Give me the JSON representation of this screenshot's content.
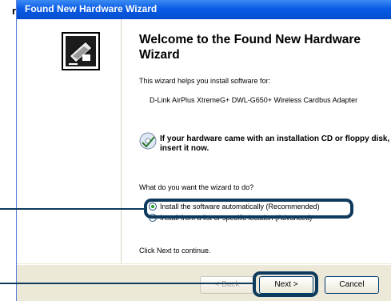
{
  "stray_char": "r",
  "window": {
    "title": "Found New Hardware Wizard"
  },
  "wizard": {
    "heading": "Welcome to the Found New Hardware Wizard",
    "intro": "This wizard helps you install software for:",
    "device": "D-Link AirPlus XtremeG+ DWL-G650+ Wireless Cardbus Adapter",
    "cd_prompt": "If your hardware came with an installation CD or floppy disk, insert it now.",
    "question": "What do you want the wizard to do?",
    "options": [
      {
        "label": "Install the software automatically (Recommended)",
        "selected": true
      },
      {
        "label": "Install from a list or specific location (Advanced)",
        "selected": false
      }
    ],
    "continue_text": "Click Next to continue."
  },
  "buttons": {
    "back": "< Back",
    "next": "Next >",
    "cancel": "Cancel"
  },
  "colors": {
    "callout": "#0e3a5e",
    "titlebar": "#0454d8",
    "dialog_bg": "#ece9d8"
  }
}
